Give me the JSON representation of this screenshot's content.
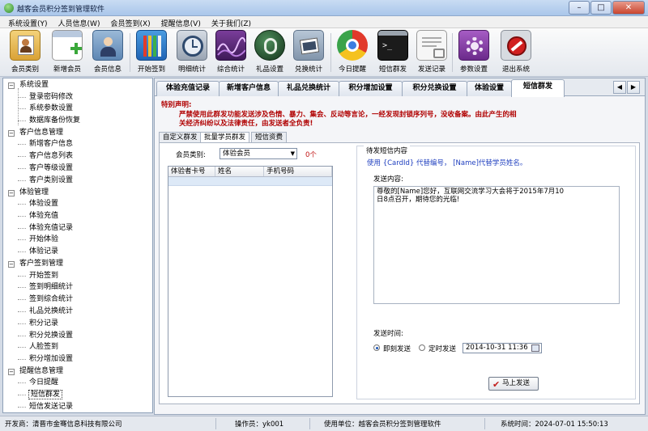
{
  "window": {
    "title": "越客会员积分签到管理软件"
  },
  "menu": [
    "系统设置(Y)",
    "人员信息(W)",
    "会员签到(X)",
    "提醒信息(V)",
    "关于我们(Z)"
  ],
  "toolbar": [
    {
      "label": "会员类别",
      "icon": "person-folder-icon"
    },
    {
      "label": "新增会员",
      "icon": "add-document-icon"
    },
    {
      "label": "会员信息",
      "icon": "person-card-icon"
    },
    {
      "label": "开始签到",
      "icon": "pencils-icon"
    },
    {
      "label": "明细统计",
      "icon": "clock-history-icon"
    },
    {
      "label": "综合统计",
      "icon": "wave-chart-icon"
    },
    {
      "label": "礼品设置",
      "icon": "gift-icon"
    },
    {
      "label": "兑换统计",
      "icon": "photo-folder-icon"
    },
    {
      "label": "今日提醒",
      "icon": "browser-globe-icon"
    },
    {
      "label": "短信群发",
      "icon": "terminal-icon"
    },
    {
      "label": "发送记录",
      "icon": "text-file-icon"
    },
    {
      "label": "参数设置",
      "icon": "gear-icon"
    },
    {
      "label": "退出系统",
      "icon": "exit-icon"
    }
  ],
  "sidebar": [
    {
      "group": "系统设置",
      "items": [
        "登录密码修改",
        "系统参数设置",
        "数据库备份恢复"
      ]
    },
    {
      "group": "客户信息管理",
      "items": [
        "新增客户信息",
        "客户信息列表",
        "客户等级设置",
        "客户类别设置"
      ]
    },
    {
      "group": "体验管理",
      "items": [
        "体验设置",
        "体验充值",
        "体验充值记录",
        "开始体验",
        "体验记录"
      ]
    },
    {
      "group": "客户签到管理",
      "items": [
        "开始签到",
        "签到明细统计",
        "签到综合统计",
        "礼品兑换统计",
        "积分记录",
        "积分兑换设置",
        "人脸签到",
        "积分增加设置"
      ]
    },
    {
      "group": "提醒信息管理",
      "items": [
        "今日提醒",
        "短信群发",
        "短信发送记录"
      ]
    }
  ],
  "tabs": [
    "体验充值记录",
    "新增客户信息",
    "礼品兑换统计",
    "积分增加设置",
    "积分兑换设置",
    "体验设置",
    "短信群发"
  ],
  "notice": {
    "title": "特别声明:",
    "body": "严禁使用此群发功能发送涉及色情、暴力、集会、反动等言论，一经发现封锁序列号，没收备案。由此产生的相关经济纠纷以及法律责任，由发送者全负责!"
  },
  "subtabs": [
    "自定义群发",
    "批量学员群发",
    "短信资费"
  ],
  "form": {
    "member_type_label": "会员类别:",
    "member_type_value": "体验会员",
    "count": "0个",
    "columns": [
      "体验者卡号",
      "姓名",
      "手机号码"
    ],
    "group_title": "待发短信内容",
    "hint": "使用 {CardId} 代替编号，  [Name]代替学员姓名。",
    "content_label": "发送内容:",
    "content": "尊敬的[Name]您好，互联网交流学习大会将于2015年7月10\n日8点召开，期待您的光临!",
    "send_time_label": "发送时间:",
    "radio_now": "即刻发送",
    "radio_timed": "定时发送",
    "datetime": "2014-10-31 11:36",
    "send_button": "马上发送"
  },
  "status": {
    "developer": "开发商：清晋市金骞信息科技有限公司",
    "operator": "操作员：yk001",
    "unit": "使用单位：越客会员积分签到管理软件",
    "time": "系统时间：2024-07-01 15:50:13"
  }
}
